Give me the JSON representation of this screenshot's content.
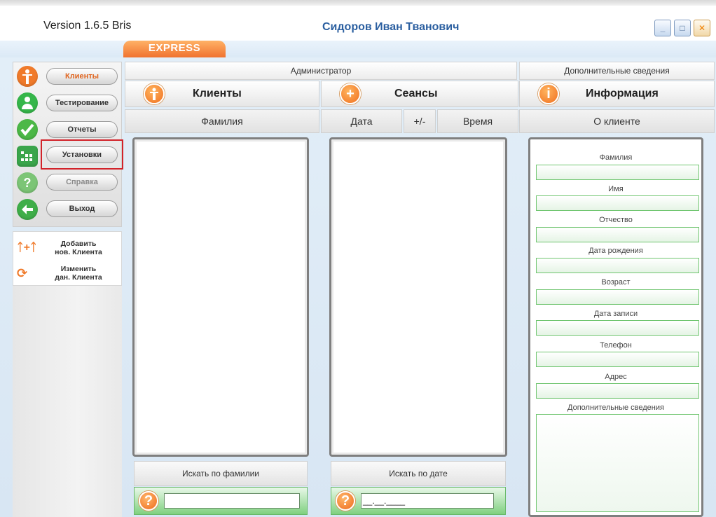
{
  "title_bar": {
    "version": "Version 1.6.5 Bris",
    "user_name": "Сидоров Иван Тванович"
  },
  "tab": {
    "label": "EXPRESS"
  },
  "sidebar": {
    "items": [
      {
        "label": "Клиенты",
        "icon": "person-icon",
        "color": "#f07a2a",
        "state": "active"
      },
      {
        "label": "Тестирование",
        "icon": "user-icon",
        "color": "#35b64a",
        "state": "normal"
      },
      {
        "label": "Отчеты",
        "icon": "checkmark-icon",
        "color": "#4cb847",
        "state": "normal"
      },
      {
        "label": "Установки",
        "icon": "grid-settings-icon",
        "color": "#3aa54b",
        "state": "highlighted"
      },
      {
        "label": "Справка",
        "icon": "help-icon",
        "color": "#7cc576",
        "state": "disabled"
      },
      {
        "label": "Выход",
        "icon": "exit-arrow-icon",
        "color": "#3fae49",
        "state": "normal"
      }
    ],
    "actions": [
      {
        "line1": "Добавить",
        "line2": "нов. Клиента",
        "icon": "add-persons-icon"
      },
      {
        "line1": "Изменить",
        "line2": "дан. Клиента",
        "icon": "refresh-icon"
      }
    ]
  },
  "headers": {
    "admin": "Администратор",
    "additional": "Дополнительные сведения",
    "clients": "Клиенты",
    "sessions": "Сеансы",
    "information": "Информация"
  },
  "columns": {
    "surname": "Фамилия",
    "date": "Дата",
    "plus_minus": "+/-",
    "time": "Время",
    "about_client": "О клиенте"
  },
  "search": {
    "by_surname_label": "Искать по фамилии",
    "by_surname_value": "",
    "by_date_label": "Искать по дате",
    "by_date_value": "__.__.____"
  },
  "client_info": {
    "fields": [
      "Фамилия",
      "Имя",
      "Отчество",
      "Дата рождения",
      "Возраст",
      "Дата записи",
      "Телефон",
      "Адрес"
    ],
    "notes_label": "Дополнительные сведения"
  },
  "window_controls": {
    "minimize": "_",
    "maximize": "□",
    "close": "✕"
  }
}
